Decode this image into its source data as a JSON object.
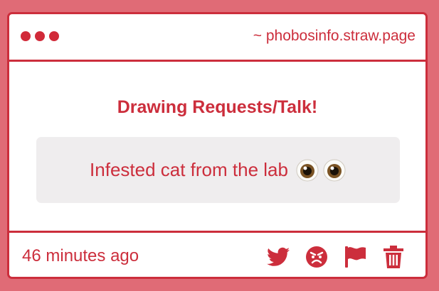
{
  "window": {
    "url": "~ phobosinfo.straw.page"
  },
  "main": {
    "heading": "Drawing Requests/Talk!",
    "message": "Infested cat from the lab",
    "message_emoji": "eyes-emoji"
  },
  "footer": {
    "timestamp": "46 minutes ago",
    "actions": [
      "twitter-icon",
      "angry-face-icon",
      "flag-icon",
      "trash-icon"
    ]
  },
  "colors": {
    "accent": "#cc2e3c",
    "background": "#e06b76",
    "message_box": "#efedee"
  }
}
